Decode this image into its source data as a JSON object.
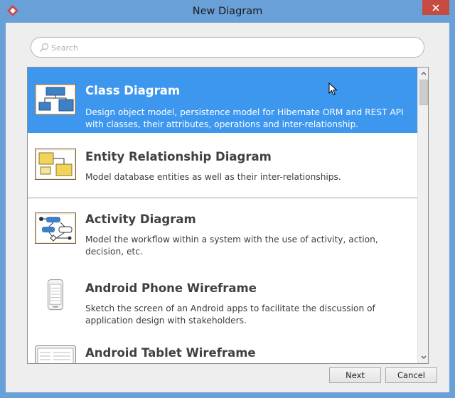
{
  "window": {
    "title": "New Diagram"
  },
  "search": {
    "placeholder": "Search",
    "value": ""
  },
  "diagrams": [
    {
      "title": "Class Diagram",
      "description": "Design object model, persistence model for Hibernate ORM and REST API with classes, their attributes, operations and inter-relationship.",
      "selected": true,
      "icon": "class-diagram-thumbnail"
    },
    {
      "title": "Entity Relationship Diagram",
      "description": "Model database entities as well as their inter-relationships.",
      "selected": false,
      "icon": "erd-thumbnail"
    },
    {
      "title": "Activity Diagram",
      "description": "Model the workflow within a system with the use of activity, action, decision, etc.",
      "selected": false,
      "icon": "activity-diagram-thumbnail"
    },
    {
      "title": "Android Phone Wireframe",
      "description": "Sketch the screen of an Android apps to facilitate the discussion of application design with stakeholders.",
      "selected": false,
      "icon": "android-phone-thumbnail"
    },
    {
      "title": "Android Tablet Wireframe",
      "description": "",
      "selected": false,
      "icon": "android-tablet-thumbnail"
    }
  ],
  "buttons": {
    "next": "Next",
    "cancel": "Cancel"
  },
  "colors": {
    "selection": "#3d97ee",
    "window_frame": "#6aa0d8",
    "close_button": "#c74a41"
  }
}
